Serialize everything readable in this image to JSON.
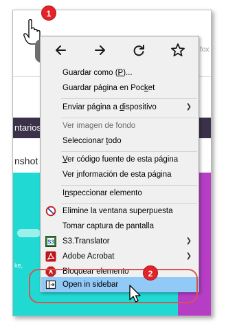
{
  "background": {
    "toolbar_tail": "fox",
    "banner_text": "ntarios",
    "shot_text": "nshot",
    "cyan_text": "ke,"
  },
  "badges": {
    "first": "1",
    "second": "2"
  },
  "menu": {
    "nav_icons": [
      "back-arrow",
      "forward-arrow",
      "reload",
      "bookmark-star"
    ],
    "items": [
      {
        "label_pre": "Guardar como (",
        "label_u": "P",
        "label_post": ")...",
        "enabled": true
      },
      {
        "label_pre": "Guardar página en Poc",
        "label_u": "k",
        "label_post": "et",
        "enabled": true
      },
      {
        "label_pre": "Enviar página a ",
        "label_u": "d",
        "label_post": "ispositivo",
        "enabled": true,
        "submenu": true
      },
      {
        "label_pre": "Ver imagen de fondo",
        "label_u": "",
        "label_post": "",
        "enabled": false
      },
      {
        "label_pre": "Seleccionar ",
        "label_u": "t",
        "label_post": "odo",
        "enabled": true
      },
      {
        "label_pre": "",
        "label_u": "V",
        "label_post": "er código fuente de esta página",
        "enabled": true
      },
      {
        "label_pre": "Ver ",
        "label_u": "i",
        "label_post": "nformación de esta página",
        "enabled": true
      },
      {
        "label_pre": "I",
        "label_u": "n",
        "label_post": "speccionar elemento",
        "enabled": true
      },
      {
        "label_pre": "Elimine la ventana superpuesta",
        "label_u": "",
        "label_post": "",
        "enabled": true,
        "icon": "no-entry-icon"
      },
      {
        "label_pre": "Tomar captura de pantalla",
        "label_u": "",
        "label_post": "",
        "enabled": true
      },
      {
        "label_pre": "S3.Translator",
        "label_u": "",
        "label_post": "",
        "enabled": true,
        "icon": "s3-translator-icon",
        "submenu": true
      },
      {
        "label_pre": "Adobe Acrobat",
        "label_u": "",
        "label_post": "",
        "enabled": true,
        "icon": "acrobat-icon",
        "submenu": true
      },
      {
        "label_pre": "Bloquear elemento",
        "label_u": "",
        "label_post": "",
        "enabled": true,
        "icon": "adblock-icon"
      },
      {
        "label_pre": "Open in sidebar",
        "label_u": "",
        "label_post": "",
        "enabled": true,
        "icon": "sidebar-icon",
        "highlighted": true
      }
    ]
  },
  "colors": {
    "badge": "#e2232a",
    "highlight": "#91c9f7",
    "annotation": "#d9534f",
    "page_cyan": "#21d9d3",
    "page_purple": "#b53ec5"
  }
}
